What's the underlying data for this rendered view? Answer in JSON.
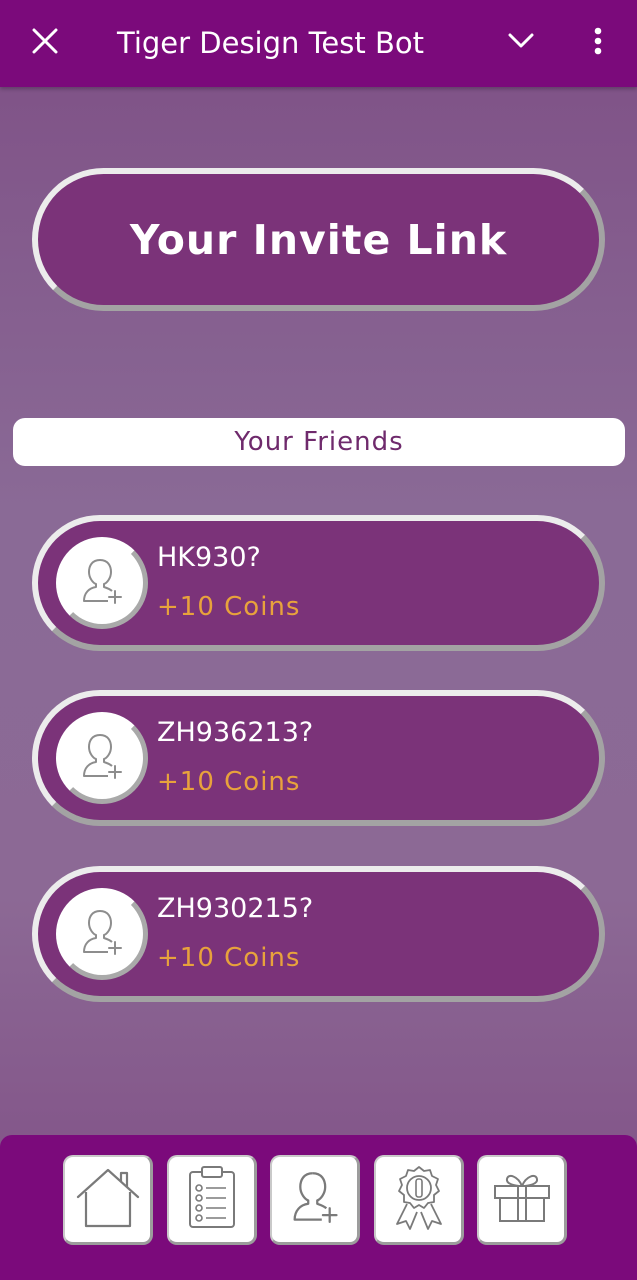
{
  "header": {
    "title": "Tiger Design Test Bot",
    "close_icon": "close-icon",
    "chevron_icon": "chevron-down-icon",
    "menu_icon": "more-vertical-icon"
  },
  "invite": {
    "label": "Your Invite Link"
  },
  "friends": {
    "header": "Your Friends",
    "items": [
      {
        "name": "HK930?",
        "reward": "+10 Coins"
      },
      {
        "name": "ZH936213?",
        "reward": "+10 Coins"
      },
      {
        "name": "ZH930215?",
        "reward": "+10 Coins"
      }
    ]
  },
  "nav": {
    "items": [
      {
        "icon": "home-icon"
      },
      {
        "icon": "tasks-clipboard-icon"
      },
      {
        "icon": "add-friend-icon"
      },
      {
        "icon": "award-badge-icon"
      },
      {
        "icon": "gift-icon"
      }
    ]
  },
  "colors": {
    "topbar": "#7b0a7b",
    "pill": "#7b3379",
    "coins": "#e8a23c",
    "background": "#8a6a96"
  }
}
